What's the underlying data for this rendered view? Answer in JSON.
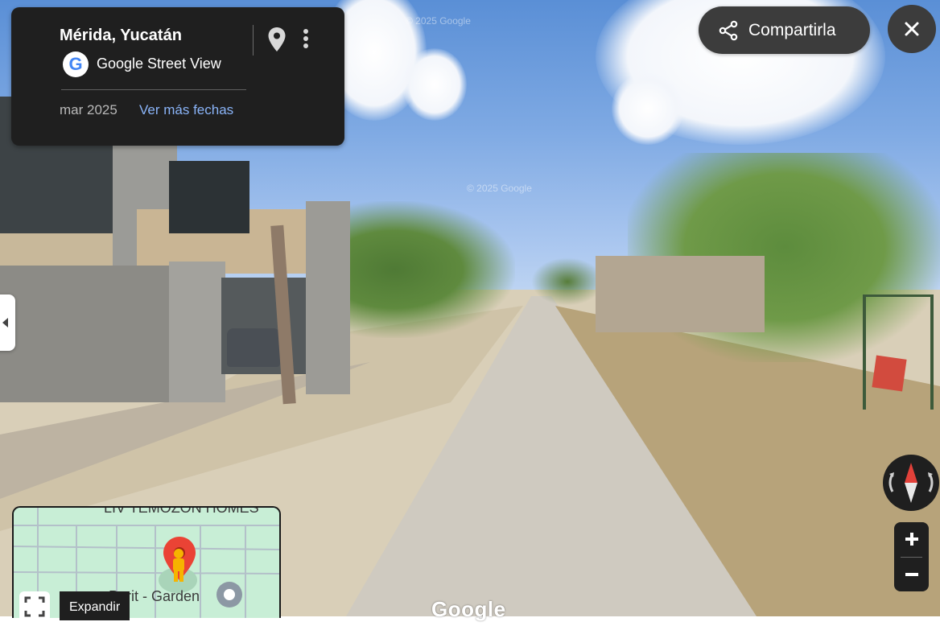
{
  "location": {
    "title": "Mérida, Yucatán",
    "source": "Google Street View"
  },
  "date": {
    "current": "mar 2025",
    "more_dates": "Ver más fechas"
  },
  "header": {
    "share_label": "Compartirla"
  },
  "watermark": {
    "text": "© 2025 Google"
  },
  "minimap": {
    "top_label": "LIV TEMOZON HOMES",
    "place_label": "Parit - Garden",
    "expand_tooltip": "Expandir"
  },
  "footer": {
    "brand": "Google"
  },
  "colors": {
    "card_bg": "#1f1f1f",
    "link": "#8ab4f8",
    "pin_red": "#ea4335",
    "map_bg": "#c8eed6"
  },
  "icons": [
    "location-pin-icon",
    "more-vert-icon",
    "share-icon",
    "close-icon",
    "chevron-left-icon",
    "compass-icon",
    "zoom-in-icon",
    "zoom-out-icon",
    "fullscreen-icon",
    "pegman-icon"
  ]
}
